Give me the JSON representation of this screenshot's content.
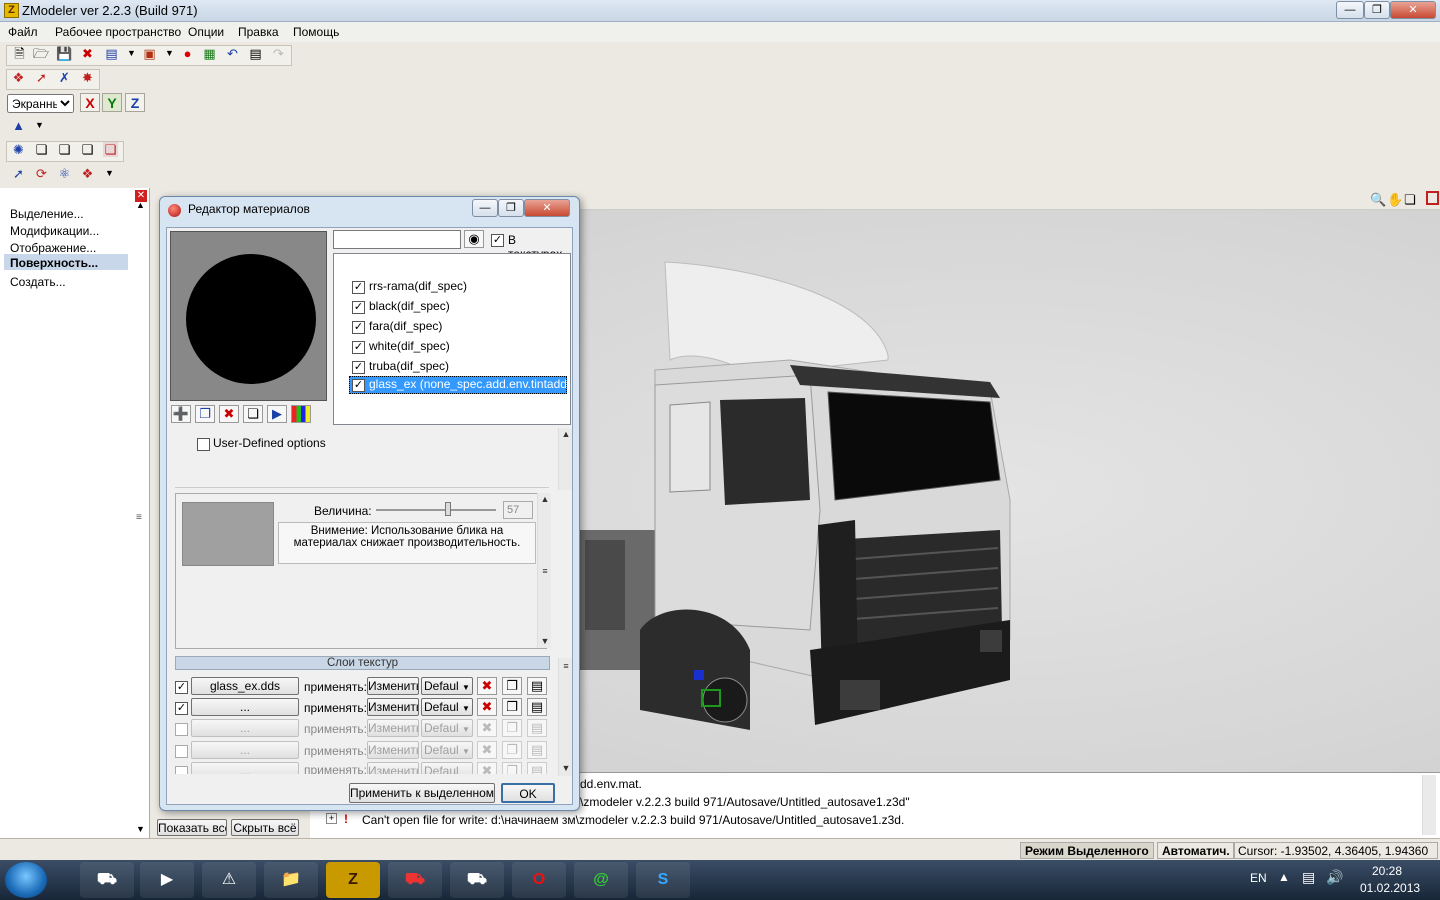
{
  "window": {
    "title": "ZModeler ver 2.2.3 (Build 971)"
  },
  "menu": [
    "Файл",
    "Рабочее пространство",
    "Опции",
    "Правка",
    "Помощь"
  ],
  "toolbar": {
    "view_combo": "Экраннь",
    "axes": [
      "X",
      "Y",
      "Z"
    ]
  },
  "left_panel": {
    "items": [
      "Выделение...",
      "Модификации...",
      "Отображение...",
      "Поверхность...",
      "Создать..."
    ],
    "selected_index": 3,
    "show_all": "Показать всё",
    "hide_all": "Скрыть всё"
  },
  "dialog": {
    "title": "Редактор материалов",
    "search_value": "",
    "in_textures_label": "В текстурах",
    "materials": [
      "rrs-rama(dif_spec)",
      "black(dif_spec)",
      "fara(dif_spec)",
      "white(dif_spec)",
      "truba(dif_spec)",
      "glass_ex (none_spec.add.env.tintadd)"
    ],
    "selected_material_index": 5,
    "user_defined_options": "User-Defined options",
    "magnitude_label": "Величина:",
    "magnitude_value": "57",
    "magnitude_fraction": 0.6,
    "warning_text": "Внимение: Использование блика на материалах снижает производительность.",
    "texture_layers_header": "Слои текстур",
    "layers": [
      {
        "name": "glass_ex.dds",
        "checked": true,
        "enabled": true
      },
      {
        "name": "...",
        "checked": true,
        "enabled": true
      },
      {
        "name": "...",
        "checked": false,
        "enabled": false
      },
      {
        "name": "...",
        "checked": false,
        "enabled": false
      },
      {
        "name": "...",
        "checked": false,
        "enabled": false
      }
    ],
    "apply_label": "применять:",
    "change_label": "Изменить",
    "default_label": "Defaul",
    "apply_selected_button": "Применить к выделенному",
    "ok_button": "OK"
  },
  "console": {
    "lines": [
      "dd.env.mat.",
      "\\zmodeler v.2.2.3 build 971/Autosave/Untitled_autosave1.z3d\"",
      "Can't open file for write: d:\\начинаем зм\\zmodeler v.2.2.3 build 971/Autosave/Untitled_autosave1.z3d."
    ]
  },
  "status": {
    "mode": "Режим Выделенного",
    "auto": "Автоматич.",
    "cursor": "Cursor: -1.93502, 4.36405, 1.94360"
  },
  "tray": {
    "lang": "EN",
    "time": "20:28",
    "date": "01.02.2013"
  },
  "colors": {
    "selection": "#3399ff",
    "viewport_bg": "#d8d8d8",
    "taskbar": "#1f2f45"
  }
}
